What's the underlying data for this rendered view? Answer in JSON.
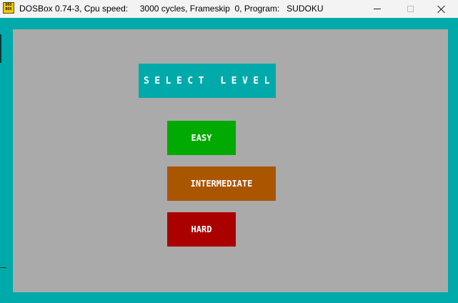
{
  "window": {
    "title": "DOSBox 0.74-3, Cpu speed:     3000 cycles, Frameskip  0, Program:   SUDOKU",
    "icon_name": "dosbox-icon",
    "icon_text_top": "DOS",
    "icon_text_bottom": "BOX",
    "controls": {
      "minimize": "minimize-icon",
      "maximize": "maximize-icon",
      "close": "close-icon"
    }
  },
  "screen": {
    "heading": "SELECT LEVEL",
    "buttons": {
      "easy": "EASY",
      "intermediate": "INTERMEDIATE",
      "hard": "HARD"
    }
  },
  "colors": {
    "border_cyan": "#00aaaa",
    "background_gray": "#aaaaaa",
    "easy_green": "#00aa00",
    "intermediate_brown": "#aa5500",
    "hard_red": "#aa0000",
    "text_white": "#ffffff"
  }
}
